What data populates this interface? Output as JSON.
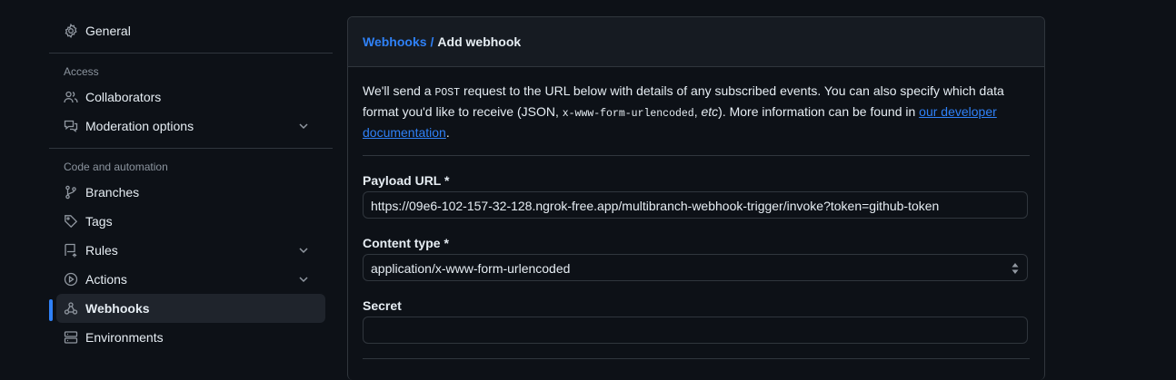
{
  "sidebar": {
    "general": "General",
    "access_heading": "Access",
    "collaborators": "Collaborators",
    "moderation": "Moderation options",
    "code_heading": "Code and automation",
    "branches": "Branches",
    "tags": "Tags",
    "rules": "Rules",
    "actions": "Actions",
    "webhooks": "Webhooks",
    "environments": "Environments"
  },
  "main": {
    "breadcrumb_link": "Webhooks",
    "breadcrumb_sep": "/",
    "breadcrumb_current": "Add webhook",
    "intro_1": "We'll send a ",
    "intro_post": "POST",
    "intro_2": " request to the URL below with details of any subscribed events. You can also specify which data format you'd like to receive (JSON, ",
    "intro_form": "x-www-form-urlencoded",
    "intro_3": ", ",
    "intro_etc": "etc",
    "intro_4": "). More information can be found in ",
    "intro_link": "our developer documentation",
    "intro_5": ".",
    "payload_label": "Payload URL *",
    "payload_value": "https://09e6-102-157-32-128.ngrok-free.app/multibranch-webhook-trigger/invoke?token=github-token",
    "content_type_label": "Content type *",
    "content_type_value": "application/x-www-form-urlencoded",
    "secret_label": "Secret",
    "secret_value": ""
  },
  "colors": {
    "bg": "#0d1117",
    "accent": "#2f81f7",
    "border": "#30363d",
    "muted": "#8b949e"
  }
}
